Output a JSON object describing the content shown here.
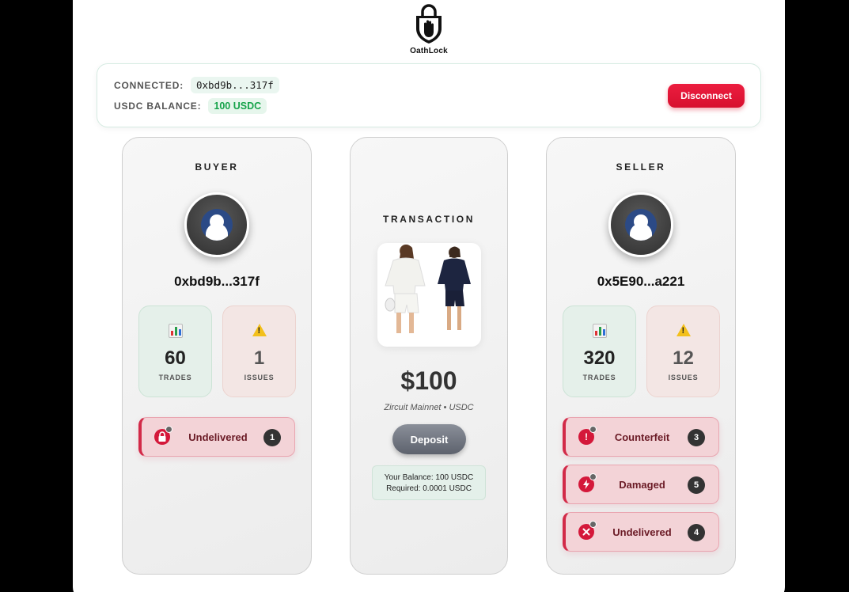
{
  "app": {
    "name": "OathLock"
  },
  "connection": {
    "connected_label": "CONNECTED:",
    "address": "0xbd9b...317f",
    "balance_label": "USDC BALANCE:",
    "balance": "100 USDC",
    "disconnect_label": "Disconnect"
  },
  "buyer": {
    "title": "BUYER",
    "wallet": "0xbd9b...317f",
    "trades": "60",
    "trades_label": "TRADES",
    "issues": "1",
    "issues_label": "ISSUES",
    "disputes": [
      {
        "label": "Undelivered",
        "count": "1",
        "icon": "lock-icon"
      }
    ]
  },
  "transaction": {
    "title": "TRANSACTION",
    "price": "$100",
    "network": "Zircuit Mainnet • USDC",
    "deposit_label": "Deposit",
    "your_balance": "Your Balance: 100 USDC",
    "required": "Required: 0.0001 USDC",
    "product_image": "product-image-two-outfits"
  },
  "seller": {
    "title": "SELLER",
    "wallet": "0x5E90...a221",
    "trades": "320",
    "trades_label": "TRADES",
    "issues": "12",
    "issues_label": "ISSUES",
    "disputes": [
      {
        "label": "Counterfeit",
        "count": "3",
        "icon": "exclamation-icon"
      },
      {
        "label": "Damaged",
        "count": "5",
        "icon": "lightning-icon"
      },
      {
        "label": "Undelivered",
        "count": "4",
        "icon": "x-icon"
      }
    ]
  },
  "colors": {
    "accent_red": "#e11d3f",
    "usdc_green": "#16a34a",
    "avatar_blue": "#2b4a86"
  }
}
